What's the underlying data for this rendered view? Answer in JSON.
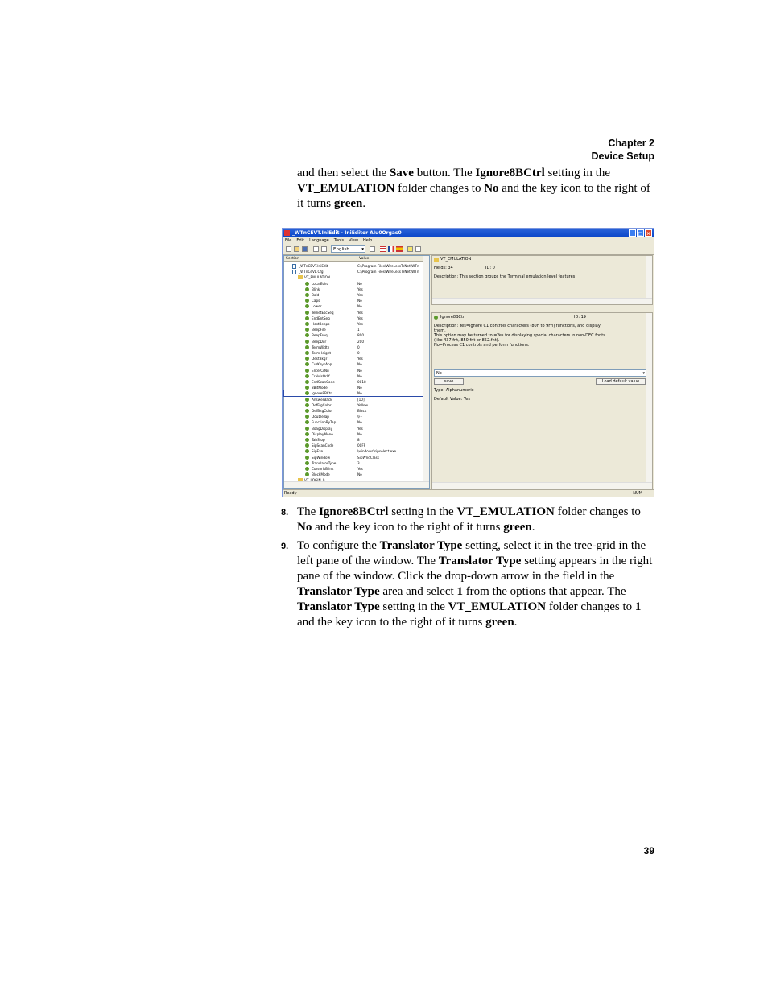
{
  "header": {
    "chapter": "Chapter 2",
    "section": "Device Setup"
  },
  "intro": [
    {
      "t": "and then select the "
    },
    {
      "b": "Save"
    },
    {
      "t": " button. The "
    },
    {
      "b": "Ignore8BCtrl"
    },
    {
      "t": " setting in the "
    },
    {
      "b": "VT_EMULATION"
    },
    {
      "t": " folder changes to "
    },
    {
      "b": "No"
    },
    {
      "t": " and the key icon to the right of it turns "
    },
    {
      "b": "green"
    },
    {
      "t": "."
    }
  ],
  "steps": [
    {
      "num": "8.",
      "parts": [
        {
          "t": "The "
        },
        {
          "b": "Ignore8BCtrl"
        },
        {
          "t": " setting in the "
        },
        {
          "b": "VT_EMULATION"
        },
        {
          "t": " folder changes to "
        },
        {
          "b": "No"
        },
        {
          "t": " and the key icon to the right of it turns "
        },
        {
          "b": "green"
        },
        {
          "t": "."
        }
      ]
    },
    {
      "num": "9.",
      "parts": [
        {
          "t": "To configure the "
        },
        {
          "b": "Translator Type"
        },
        {
          "t": " setting, select it in the tree-grid in the left pane of the window. The "
        },
        {
          "b": "Translator Type"
        },
        {
          "t": " setting appears in the right pane of the window. Click the drop-down arrow in the field in the "
        },
        {
          "b": "Translator Type"
        },
        {
          "t": " area and select "
        },
        {
          "b": "1"
        },
        {
          "t": " from the options that appear. The "
        },
        {
          "b": "Translator Type"
        },
        {
          "t": " setting in the "
        },
        {
          "b": "VT_EMULATION"
        },
        {
          "t": " folder changes to "
        },
        {
          "b": "1"
        },
        {
          "t": " and the key icon to the right of it turns "
        },
        {
          "b": "green"
        },
        {
          "t": "."
        }
      ]
    }
  ],
  "page_number": "39",
  "window": {
    "title": "_WTnCEVT.IniEdit - IniEditor AIu0Orgas0",
    "menu": [
      "File",
      "Edit",
      "Language",
      "Tools",
      "View",
      "Help"
    ],
    "language": "English",
    "columns": {
      "section": "Section",
      "value": "Value"
    },
    "rows": [
      {
        "n": "_WTnCEVT.IniEdit",
        "v": "C:\\Program Files\\WireLessTeNet\\WTn",
        "lvl": 0,
        "icon": "doc"
      },
      {
        "n": "_WTnCeVL.Cfg",
        "v": "C:\\Program Files\\WireLessTeNet\\WTn",
        "lvl": 0,
        "icon": "doc"
      },
      {
        "n": "VT_EMULATION",
        "v": "",
        "lvl": 1,
        "icon": "folder"
      },
      {
        "n": "LocalEcho",
        "v": "No",
        "lvl": 2,
        "icon": "key"
      },
      {
        "n": "Blink",
        "v": "Yes",
        "lvl": 2,
        "icon": "key"
      },
      {
        "n": "Bold",
        "v": "Yes",
        "lvl": 2,
        "icon": "key"
      },
      {
        "n": "Caps",
        "v": "No",
        "lvl": 2,
        "icon": "key"
      },
      {
        "n": "Lower",
        "v": "No",
        "lvl": 2,
        "icon": "key"
      },
      {
        "n": "TelnetEscSeq",
        "v": "Yes",
        "lvl": 2,
        "icon": "key"
      },
      {
        "n": "EndEntSeq",
        "v": "Yes",
        "lvl": 2,
        "icon": "key"
      },
      {
        "n": "HostBeeps",
        "v": "Yes",
        "lvl": 2,
        "icon": "key"
      },
      {
        "n": "BeepFile",
        "v": "1",
        "lvl": 2,
        "icon": "key"
      },
      {
        "n": "BeepFreq",
        "v": "800",
        "lvl": 2,
        "icon": "key"
      },
      {
        "n": "BeepDur",
        "v": "200",
        "lvl": 2,
        "icon": "key"
      },
      {
        "n": "TermWidth",
        "v": "0",
        "lvl": 2,
        "icon": "key"
      },
      {
        "n": "TermHeight",
        "v": "0",
        "lvl": 2,
        "icon": "key"
      },
      {
        "n": "DestBkgr",
        "v": "Yes",
        "lvl": 2,
        "icon": "key"
      },
      {
        "n": "CurKeysApp",
        "v": "No",
        "lvl": 2,
        "icon": "key"
      },
      {
        "n": "EnterCrNu",
        "v": "No",
        "lvl": 2,
        "icon": "key"
      },
      {
        "n": "CrNulsOrLf",
        "v": "No",
        "lvl": 2,
        "icon": "key"
      },
      {
        "n": "EndScanCode",
        "v": "0018",
        "lvl": 2,
        "icon": "key"
      },
      {
        "n": "8BitMode",
        "v": "No",
        "lvl": 2,
        "icon": "key"
      },
      {
        "n": "Ignore8BCtrl",
        "v": "No",
        "lvl": 2,
        "icon": "key",
        "sel": true
      },
      {
        "n": "AnswerBack",
        "v": "[10]",
        "lvl": 2,
        "icon": "key"
      },
      {
        "n": "DefFrgColor",
        "v": "Yellow",
        "lvl": 2,
        "icon": "key"
      },
      {
        "n": "DefBkgColor",
        "v": "Black",
        "lvl": 2,
        "icon": "key"
      },
      {
        "n": "DoubleTap",
        "v": "\\FF",
        "lvl": 2,
        "icon": "key"
      },
      {
        "n": "FunctionByTap",
        "v": "No",
        "lvl": 2,
        "icon": "key"
      },
      {
        "n": "BoagDisplay",
        "v": "Yes",
        "lvl": 2,
        "icon": "key"
      },
      {
        "n": "DisplayMono",
        "v": "No",
        "lvl": 2,
        "icon": "key"
      },
      {
        "n": "TabStop",
        "v": "8",
        "lvl": 2,
        "icon": "key"
      },
      {
        "n": "SipScanCode",
        "v": "00FF",
        "lvl": 2,
        "icon": "key"
      },
      {
        "n": "SipExe",
        "v": "\\windows\\sipselect.exe",
        "lvl": 2,
        "icon": "key"
      },
      {
        "n": "SipWindow",
        "v": "SipWndClass",
        "lvl": 2,
        "icon": "key"
      },
      {
        "n": "TranslatorType",
        "v": "3",
        "lvl": 2,
        "icon": "key"
      },
      {
        "n": "CursorIsBlink",
        "v": "Yes",
        "lvl": 2,
        "icon": "key"
      },
      {
        "n": "BlockMode",
        "v": "No",
        "lvl": 2,
        "icon": "key"
      },
      {
        "n": "VT_LOGIN_0",
        "v": "",
        "lvl": 1,
        "icon": "folder"
      }
    ],
    "top_pane": {
      "name": "VT_EMULATION",
      "fields": "Fields: 34",
      "id": "ID: 0",
      "description": "Description: This section groups the Terminal emulation level features"
    },
    "bottom_pane": {
      "name": "Ignore8BCtrl",
      "id": "ID: 19",
      "desc": [
        "Description: Yes=Ignore C1 controls characters (80h to 9Fh) functions, and display",
        "them.",
        "This option may be turned to =Yes for displaying special characters in non-DEC fonts",
        "(like 437.fnt, 850.fnt or 852.fnt).",
        "No=Process C1 controls and perform functions."
      ],
      "value": "No",
      "save_label": "save",
      "load_default_label": "Load default value",
      "type": "Type: Alphanumeric",
      "default": "Default Value: Yes"
    },
    "status_left": "Ready",
    "status_right": "NUM"
  }
}
